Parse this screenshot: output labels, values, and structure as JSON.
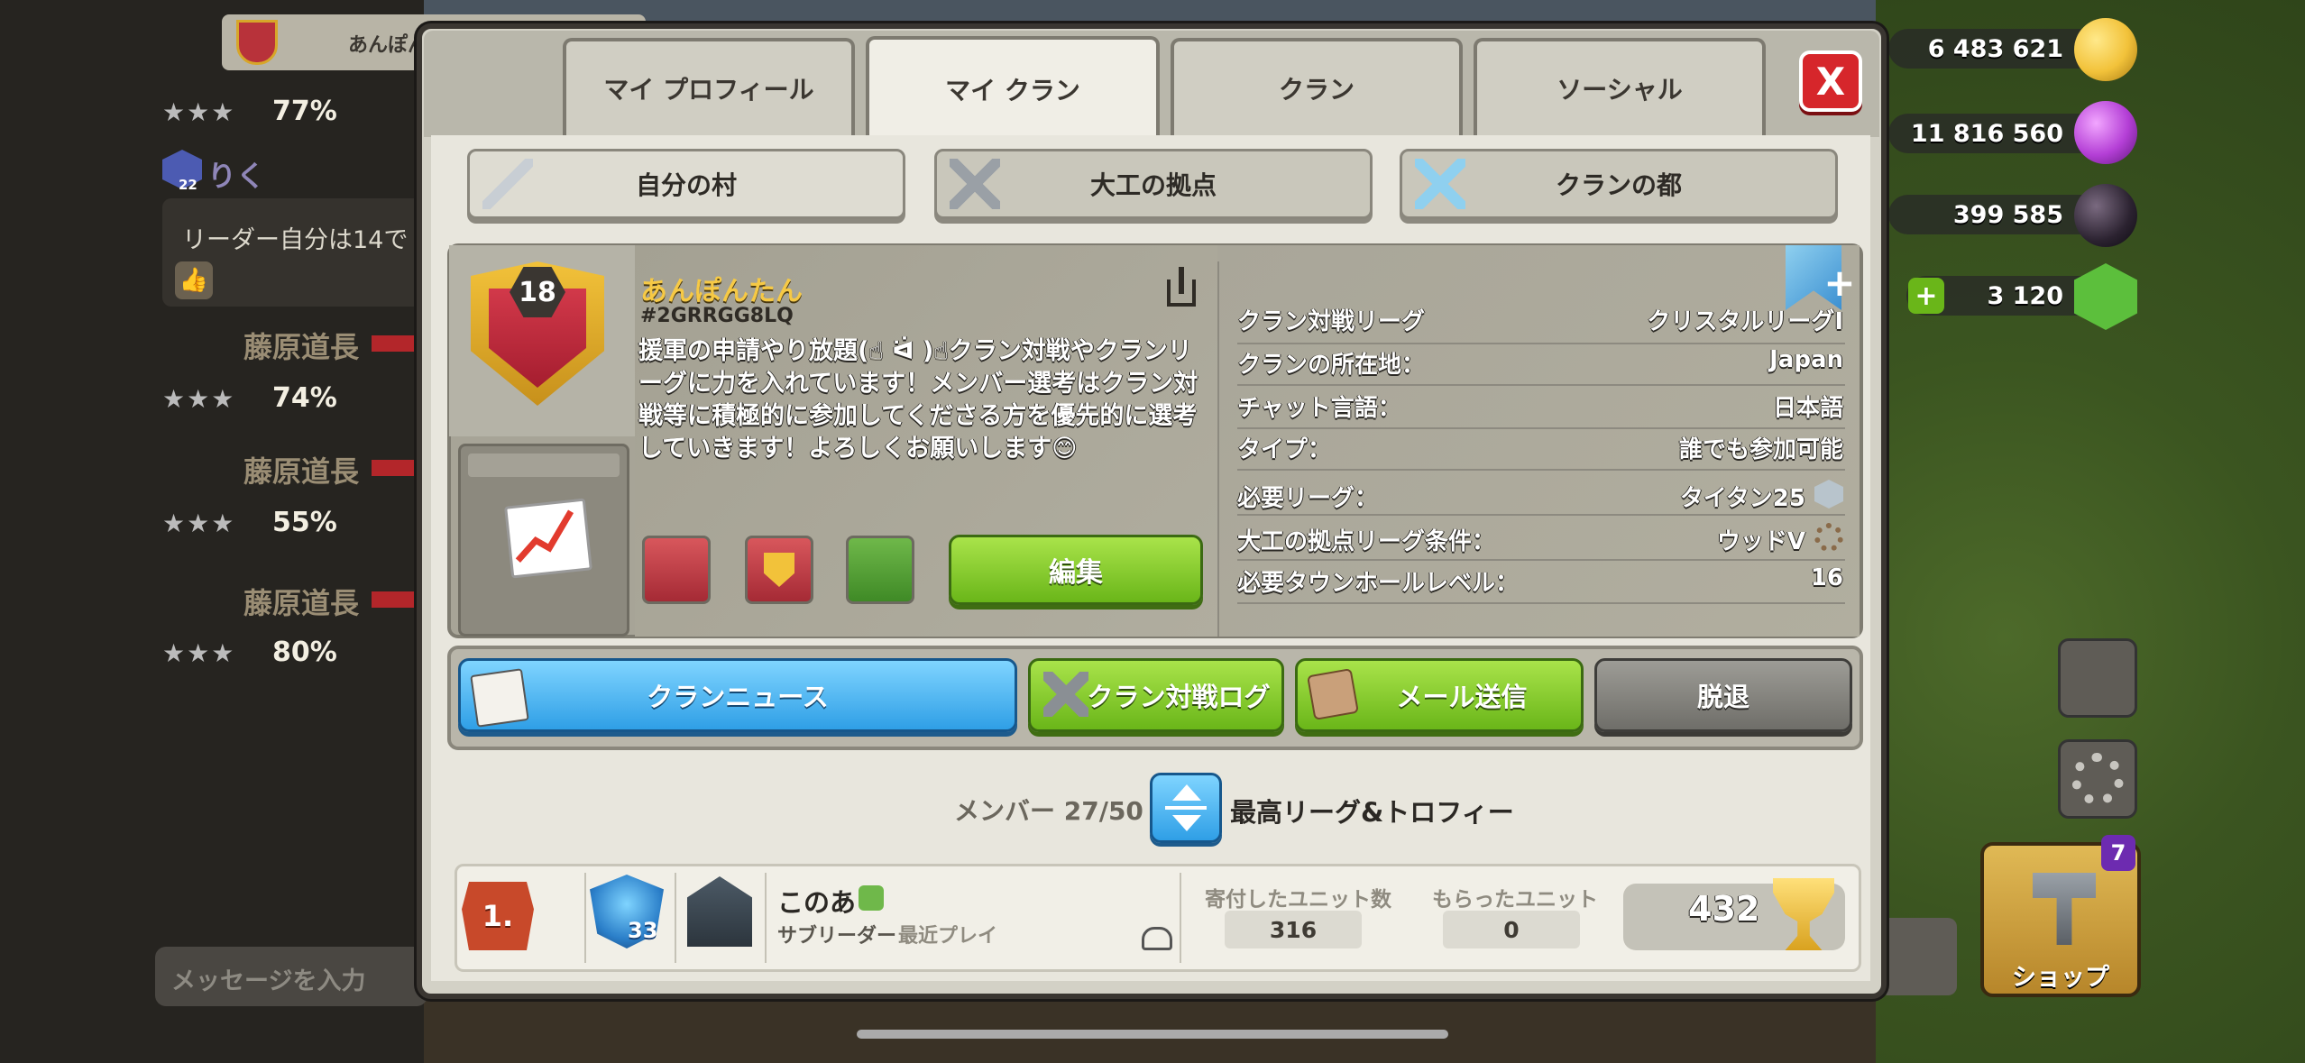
{
  "chat": {
    "top_clan_name": "あんぽんたん",
    "entries": [
      {
        "stars": "★★★",
        "percent": "77%"
      },
      {
        "stars": "★★★",
        "percent": "74%"
      },
      {
        "stars": "★★★",
        "percent": "55%"
      },
      {
        "stars": "★★★",
        "percent": "80%"
      }
    ],
    "user_name": "りく",
    "user_level": "22",
    "message": "リーダー自分は14で",
    "sender_names": [
      "藤原道長",
      "藤原道長",
      "藤原道長"
    ],
    "input_placeholder": "メッセージを入力"
  },
  "tabs": [
    {
      "label": "マイ プロフィール"
    },
    {
      "label": "マイ クラン"
    },
    {
      "label": "クラン"
    },
    {
      "label": "ソーシャル"
    }
  ],
  "close_label": "X",
  "sub_tabs": [
    {
      "label": "自分の村",
      "icon": "sword-icon"
    },
    {
      "label": "大工の拠点",
      "icon": "axes-icon"
    },
    {
      "label": "クランの都",
      "icon": "crossed-swords-icon"
    }
  ],
  "clan": {
    "level": "18",
    "name": "あんぽんたん",
    "tag": "#2GRRGG8LQ",
    "description": "援軍の申請やり放題(☝︎ ᐛ )☝︎クラン対戦やクランリーグに力を入れています！メンバー選考はクラン対戦等に積極的に参加してくださる方を優先的に選考していきます！よろしくお願いします😊",
    "edit_label": "編集",
    "details": [
      {
        "label": "クラン対戦リーグ",
        "value": "クリスタルリーグⅠ"
      },
      {
        "label": "クランの所在地：",
        "value": "Japan"
      },
      {
        "label": "チャット言語：",
        "value": "日本語"
      },
      {
        "label": "タイプ：",
        "value": "誰でも参加可能"
      },
      {
        "label": "必要リーグ：",
        "value": "タイタン25"
      },
      {
        "label": "大工の拠点リーグ条件：",
        "value": "ウッドⅤ"
      },
      {
        "label": "必要タウンホールレベル：",
        "value": "16"
      }
    ]
  },
  "actions": [
    {
      "label": "クランニュース",
      "icon": "news-icon"
    },
    {
      "label": "クラン対戦ログ",
      "icon": "war-log-icon"
    },
    {
      "label": "メール送信",
      "icon": "mail-icon"
    },
    {
      "label": "脱退",
      "icon": ""
    }
  ],
  "members": {
    "label": "メンバー 27/50",
    "sort_label": "最高リーグ&トロフィー"
  },
  "member": {
    "rank": "1.",
    "xp_level": "33",
    "name": "このあ",
    "role": "サブリーダー",
    "last_seen": "最近プレイ",
    "donated_label": "寄付したユニット数",
    "donated": "316",
    "received_label": "もらったユニット",
    "received": "0",
    "trophies": "432"
  },
  "hud": {
    "gold": "6 483 621",
    "elixir": "11 816 560",
    "dark_elixir": "399 585",
    "gems": "3 120",
    "shop_label": "ショップ",
    "shop_count": "7"
  },
  "colors": {
    "gold": "#f2c23a",
    "elixir": "#b43fd6",
    "dark_elixir": "#2b2230",
    "gems": "#5cbf3c",
    "accent_green": "#6ab619",
    "accent_blue": "#2f9fe6",
    "close_red": "#d6262b"
  }
}
